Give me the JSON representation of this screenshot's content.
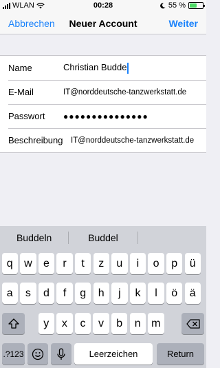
{
  "status_bar": {
    "carrier": "WLAN",
    "time": "00:28",
    "battery_percent": "55 %",
    "battery_level": 0.55
  },
  "nav": {
    "cancel_label": "Abbrechen",
    "title": "Neuer Account",
    "next_label": "Weiter"
  },
  "form": {
    "name": {
      "label": "Name",
      "value": "Christian Budde"
    },
    "email": {
      "label": "E-Mail",
      "value": "IT@norddeutsche-tanzwerkstatt.de"
    },
    "password": {
      "label": "Passwort",
      "value": "●●●●●●●●●●●●●●●"
    },
    "description": {
      "label": "Beschreibung",
      "value": "IT@norddeutsche-tanzwerkstatt.de"
    }
  },
  "keyboard": {
    "suggestions": [
      "Buddeln",
      "Buddel",
      ""
    ],
    "row1": [
      "q",
      "w",
      "e",
      "r",
      "t",
      "z",
      "u",
      "i",
      "o",
      "p",
      "ü"
    ],
    "row2": [
      "a",
      "s",
      "d",
      "f",
      "g",
      "h",
      "j",
      "k",
      "l",
      "ö",
      "ä"
    ],
    "row3": [
      "y",
      "x",
      "c",
      "v",
      "b",
      "n",
      "m"
    ],
    "numbers_label": ".?123",
    "space_label": "Leerzeichen",
    "return_label": "Return"
  }
}
